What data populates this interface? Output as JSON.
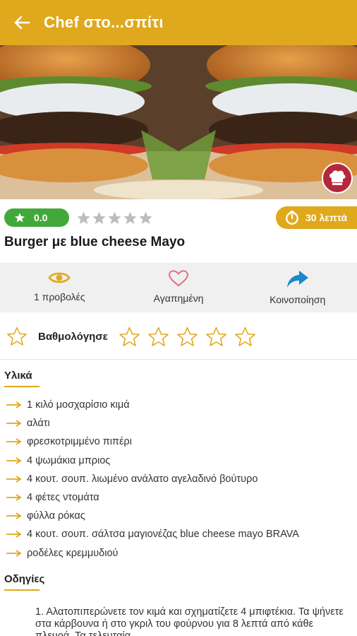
{
  "appbar": {
    "title": "Chef στο...σπίτι"
  },
  "recipe": {
    "rating": "0.0",
    "time": "30 λεπτά",
    "title": "Burger με blue cheese Mayo"
  },
  "actions": [
    {
      "label": "1 προβολές",
      "icon": "eye-icon"
    },
    {
      "label": "Αγαπημένη",
      "icon": "heart-icon"
    },
    {
      "label": "Κοινοποίηση",
      "icon": "share-icon"
    }
  ],
  "rate": {
    "label": "Βαθμολόγησε"
  },
  "ingredients": {
    "heading": "Υλικά",
    "items": [
      "1 κιλό μοσχαρίσιο κιμά",
      "αλάτι",
      "φρεσκοτριμμένο πιπέρι",
      "4 ψωμάκια μπριος",
      "4 κουτ. σουπ. λιωμένο ανάλατο αγελαδινό βούτυρο",
      "4 φέτες ντομάτα",
      "φύλλα ρόκας",
      "4 κουτ. σουπ. σάλτσα μαγιονέζας blue cheese mayo BRAVA",
      "ροδέλες κρεμμυδιού"
    ]
  },
  "instructions": {
    "heading": "Οδηγίες",
    "step1": "1. Αλατοπιπερώνετε τον κιμά και σχηματίζετε 4 μπιφτέκια. Τα ψήνετε στα κάρβουνα ή στο γκριλ του φούρνου για 8 λεπτά από κάθε πλευρά. Τα τελευταία"
  },
  "colors": {
    "accent": "#e0a81c",
    "green": "#43a83a",
    "pink": "#e0718a",
    "share": "#1e88c8"
  }
}
